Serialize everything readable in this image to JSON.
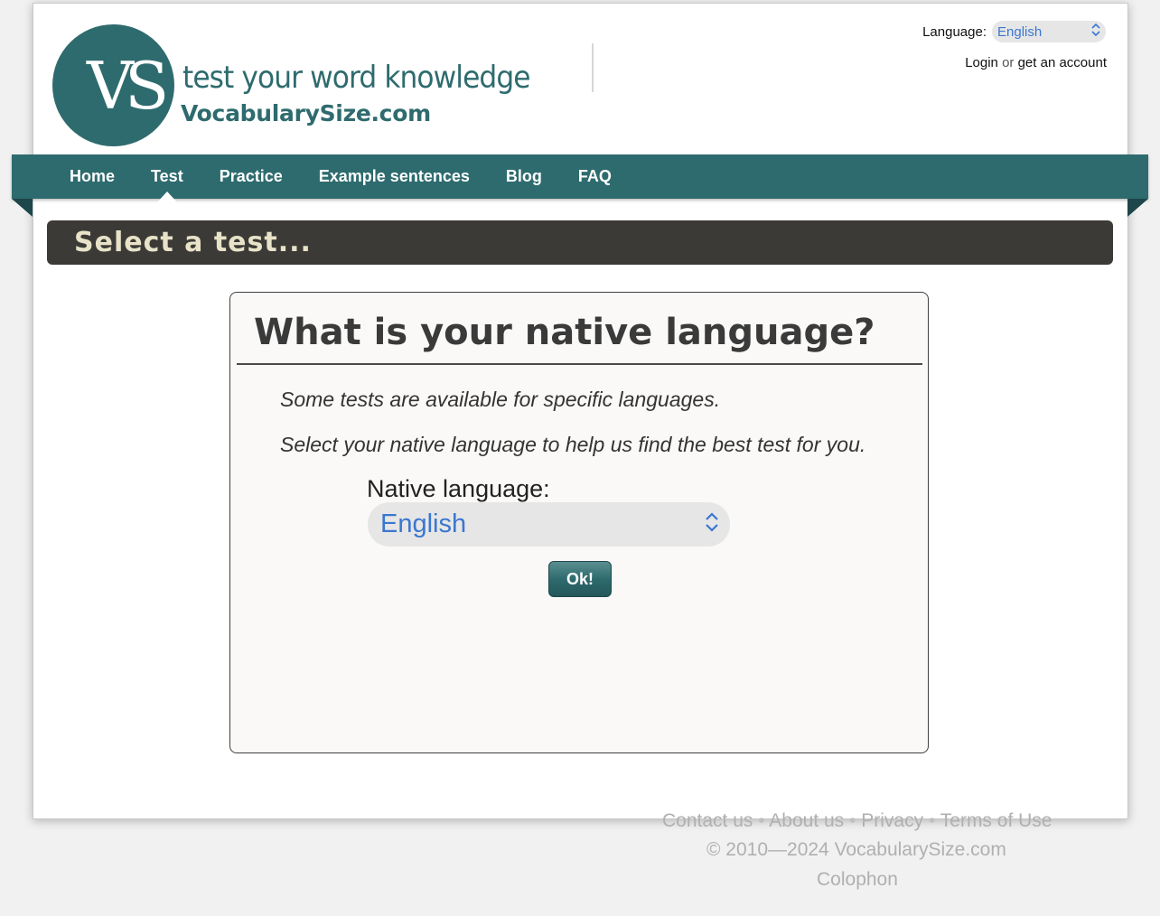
{
  "logo": {
    "mark": "VS",
    "tagline": "test your word knowledge",
    "site_name": "VocabularySize.com"
  },
  "header": {
    "language_label": "Language:",
    "language_value": "English",
    "login": "Login",
    "or": "or",
    "signup": "get an account"
  },
  "nav": {
    "items": [
      {
        "label": "Home"
      },
      {
        "label": "Test"
      },
      {
        "label": "Practice"
      },
      {
        "label": "Example sentences"
      },
      {
        "label": "Blog"
      },
      {
        "label": "FAQ"
      }
    ],
    "active": "Test"
  },
  "page_title": "Select a test...",
  "card": {
    "title": "What is your native language?",
    "line1": "Some tests are available for specific languages.",
    "line2": "Select your native language to help us find the best test for you.",
    "native_label": "Native language:",
    "native_value": "English",
    "ok_label": "Ok!"
  },
  "footer": {
    "links": [
      "Contact us",
      "About us",
      "Privacy",
      "Terms of Use"
    ],
    "separator": "•",
    "copyright": "© 2010—2024 VocabularySize.com",
    "colophon": "Colophon"
  },
  "colors": {
    "brand_teal": "#2e6b6e",
    "title_bar": "#3b3a36",
    "title_text": "#e8e3c8",
    "select_text": "#3a77d0"
  }
}
